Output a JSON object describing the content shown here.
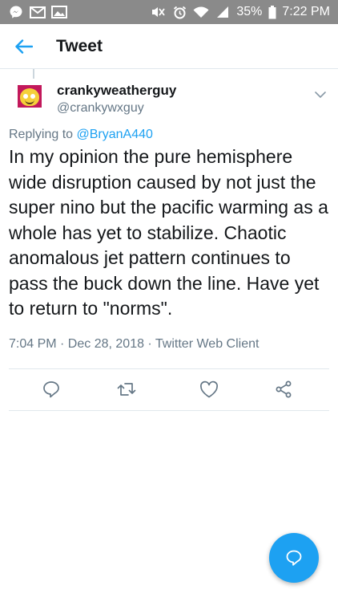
{
  "status_bar": {
    "battery_percent": "35%",
    "time": "7:22 PM",
    "left_icons": [
      "messenger-icon",
      "mail-icon",
      "image-icon"
    ],
    "right_icons": [
      "mute-icon",
      "alarm-icon",
      "wifi-icon",
      "signal-icon",
      "battery-icon"
    ]
  },
  "header": {
    "back_icon": "arrow-left-icon",
    "title": "Tweet"
  },
  "tweet": {
    "author": {
      "display_name": "crankyweatherguy",
      "handle": "@crankywxguy"
    },
    "replying_prefix": "Replying to",
    "replying_to": "@BryanA440",
    "text": "In my opinion the pure hemisphere wide disruption caused by not just the super nino but the pacific warming as a whole has yet to stabilize. Chaotic anomalous jet pattern continues to pass the buck down the line. Have yet to return to \"norms\".",
    "meta": "7:04 PM · Dec 28, 2018 · Twitter Web Client"
  },
  "actions": [
    "reply-icon",
    "retweet-icon",
    "like-icon",
    "share-icon"
  ],
  "fab": {
    "icon": "compose-reply-icon"
  },
  "colors": {
    "accent": "#1da1f2",
    "status_bar": "#8a8a8a",
    "secondary_text": "#657786",
    "primary_text": "#14171a",
    "divider": "#e1e8ed"
  }
}
